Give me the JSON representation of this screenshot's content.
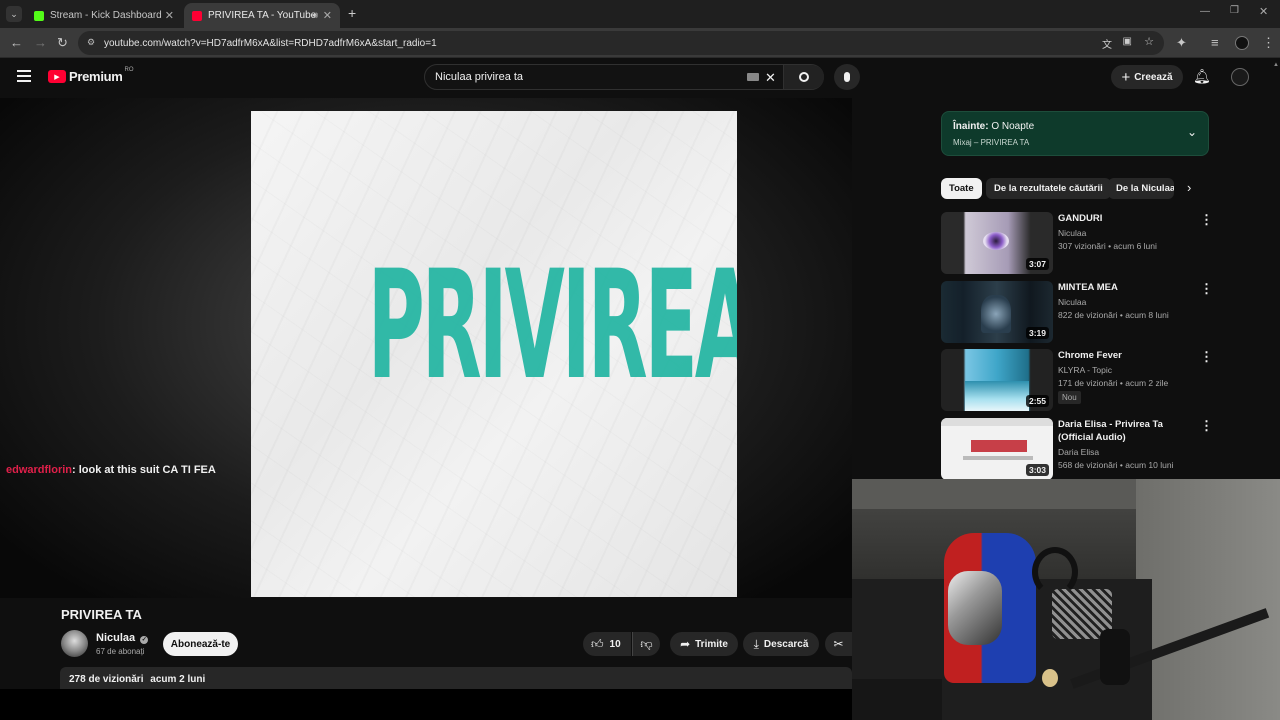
{
  "browser": {
    "tabs": [
      {
        "title": "Stream - Kick Dashboard",
        "favicon_color": "#53fc18"
      },
      {
        "title": "PRIVIREA TA - YouTube",
        "favicon_color": "#ff0033"
      }
    ],
    "url": "youtube.com/watch?v=HD7adfrM6xA&list=RDHD7adfrM6xA&start_radio=1"
  },
  "yt": {
    "logo_text": "Premium",
    "region": "RO",
    "search_value": "Niculaa privirea ta",
    "create_label": "Creează"
  },
  "player": {
    "cover_text": "PRIVIREA TA",
    "chat": {
      "user": "edwardflorin",
      "message": ": look at this suit CA TI FEA"
    }
  },
  "video": {
    "title": "PRIVIREA TA",
    "channel": "Niculaa",
    "subscribers": "67 de abonați",
    "subscribe_label": "Abonează-te",
    "likes": "10",
    "share_label": "Trimite",
    "download_label": "Descarcă",
    "views": "278 de vizionări",
    "age": "acum 2 luni"
  },
  "sidebar": {
    "up_next_prefix": "Înainte:",
    "up_next_title": "O Noapte",
    "up_next_sub": "Mixaj – PRIVIREA TA",
    "chips": [
      "Toate",
      "De la rezultatele căutării",
      "De la Niculaa"
    ],
    "items": [
      {
        "title": "GANDURI",
        "channel": "Niculaa",
        "meta": "307 vizionări • acum 6 luni",
        "duration": "3:07",
        "thumb_color": "#b9a9c9"
      },
      {
        "title": "MINTEA MEA",
        "channel": "Niculaa",
        "meta": "822 de vizionări • acum 8 luni",
        "duration": "3:19",
        "thumb_color": "#2a3640"
      },
      {
        "title": "Chrome Fever",
        "channel": "KLYRA - Topic",
        "meta": "171 de vizionări • acum 2 zile",
        "duration": "2:55",
        "badge": "Nou",
        "thumb_color": "#3fa6c9"
      },
      {
        "title": "Daria Elisa - Privirea Ta (Official Audio)",
        "channel": "Daria Elisa",
        "meta": "568 de vizionări • acum 10 luni",
        "duration": "3:03",
        "thumb_color": "#f2f2f2"
      }
    ]
  },
  "colors": {
    "accent_red": "#ff0033",
    "chat_user": "#e0204a",
    "teal": "#22b5a2",
    "up_next_bg": "#0e3a2b"
  }
}
